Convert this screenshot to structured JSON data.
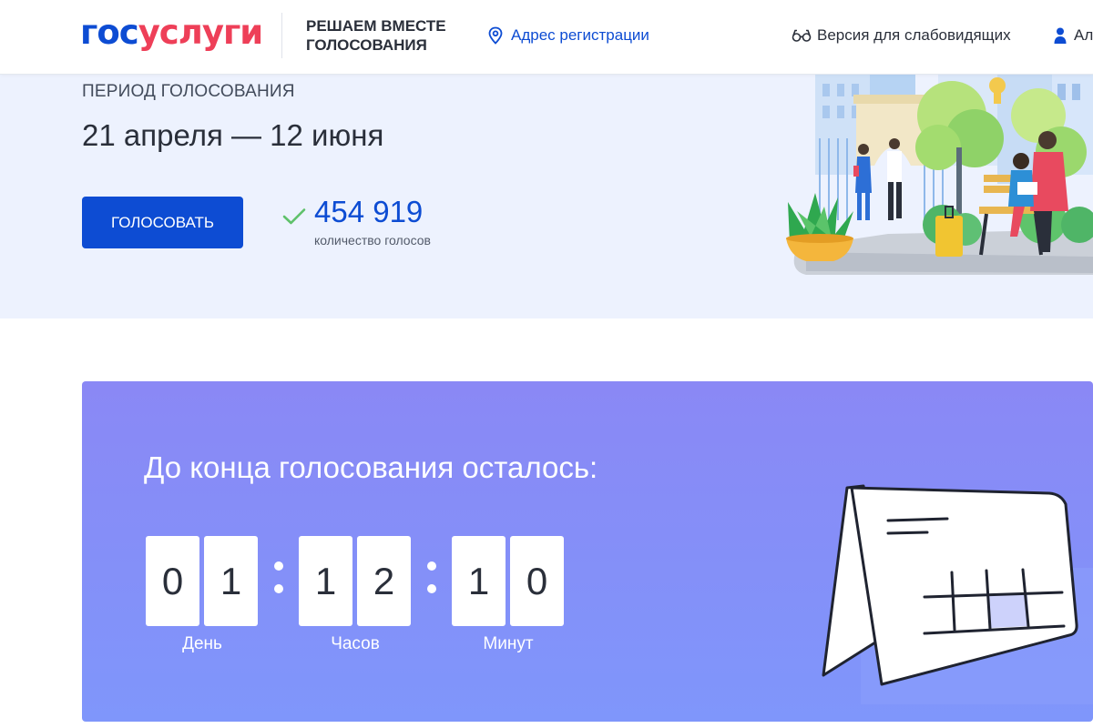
{
  "header": {
    "logo_part1": "гос",
    "logo_part2": "услуги",
    "project_title": "Решаем вместе голосования",
    "address_link": "Адрес регистрации",
    "accessibility_link": "Версия для слабовидящих",
    "user_link": "Ал",
    "brand_blue": "#0d4cd3",
    "brand_red": "#ee3f58"
  },
  "hero": {
    "period_label": "Период голосования",
    "period_dates": "21 апреля — 12 июня",
    "vote_button": "Голосовать",
    "votes_count": "454 919",
    "votes_label": "количество голосов",
    "background": "#edf2fe"
  },
  "countdown": {
    "title": "До конца голосования осталось:",
    "days": [
      "0",
      "1"
    ],
    "days_label": "День",
    "hours": [
      "1",
      "2"
    ],
    "hours_label": "Часов",
    "minutes": [
      "1",
      "0"
    ],
    "minutes_label": "Минут",
    "gradient_top": "#8a88f5",
    "gradient_bottom": "#7f96fb"
  },
  "icons": {
    "address": "location-pin-icon",
    "accessibility": "glasses-icon",
    "user": "user-icon",
    "votes": "check-icon"
  }
}
